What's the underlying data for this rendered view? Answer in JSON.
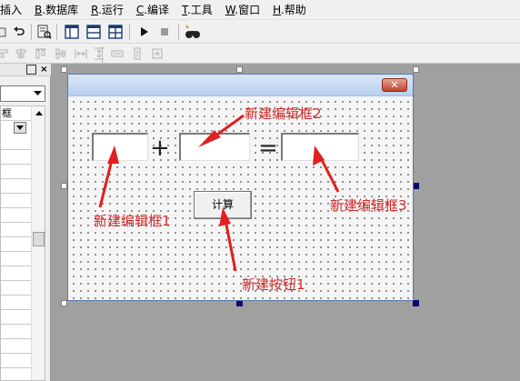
{
  "menu": [
    {
      "prefix": "",
      "key": "",
      "label": "插入"
    },
    {
      "prefix": "",
      "key": "B",
      "label": ".数据库"
    },
    {
      "prefix": "",
      "key": "R",
      "label": ".运行"
    },
    {
      "prefix": "",
      "key": "C",
      "label": ".编译"
    },
    {
      "prefix": "",
      "key": "T",
      "label": ".工具"
    },
    {
      "prefix": "",
      "key": "W",
      "label": ".窗口"
    },
    {
      "prefix": "",
      "key": "H",
      "label": ".帮助"
    }
  ],
  "left_panel": {
    "pin_icon": "window-icon",
    "close_label": "×",
    "grid_first_cell": "框"
  },
  "form": {
    "close_label": "✕",
    "plus_sign": "+",
    "equals_sign": "=",
    "button_label": "计算"
  },
  "annotations": {
    "edit1": "新建编辑框1",
    "edit2": "新建编辑框2",
    "edit3": "新建编辑框3",
    "button1": "新建按钮1"
  },
  "colors": {
    "annotation": "#d42828",
    "canvas": "#a0a0a0",
    "form_title": "#c6d8f0"
  }
}
